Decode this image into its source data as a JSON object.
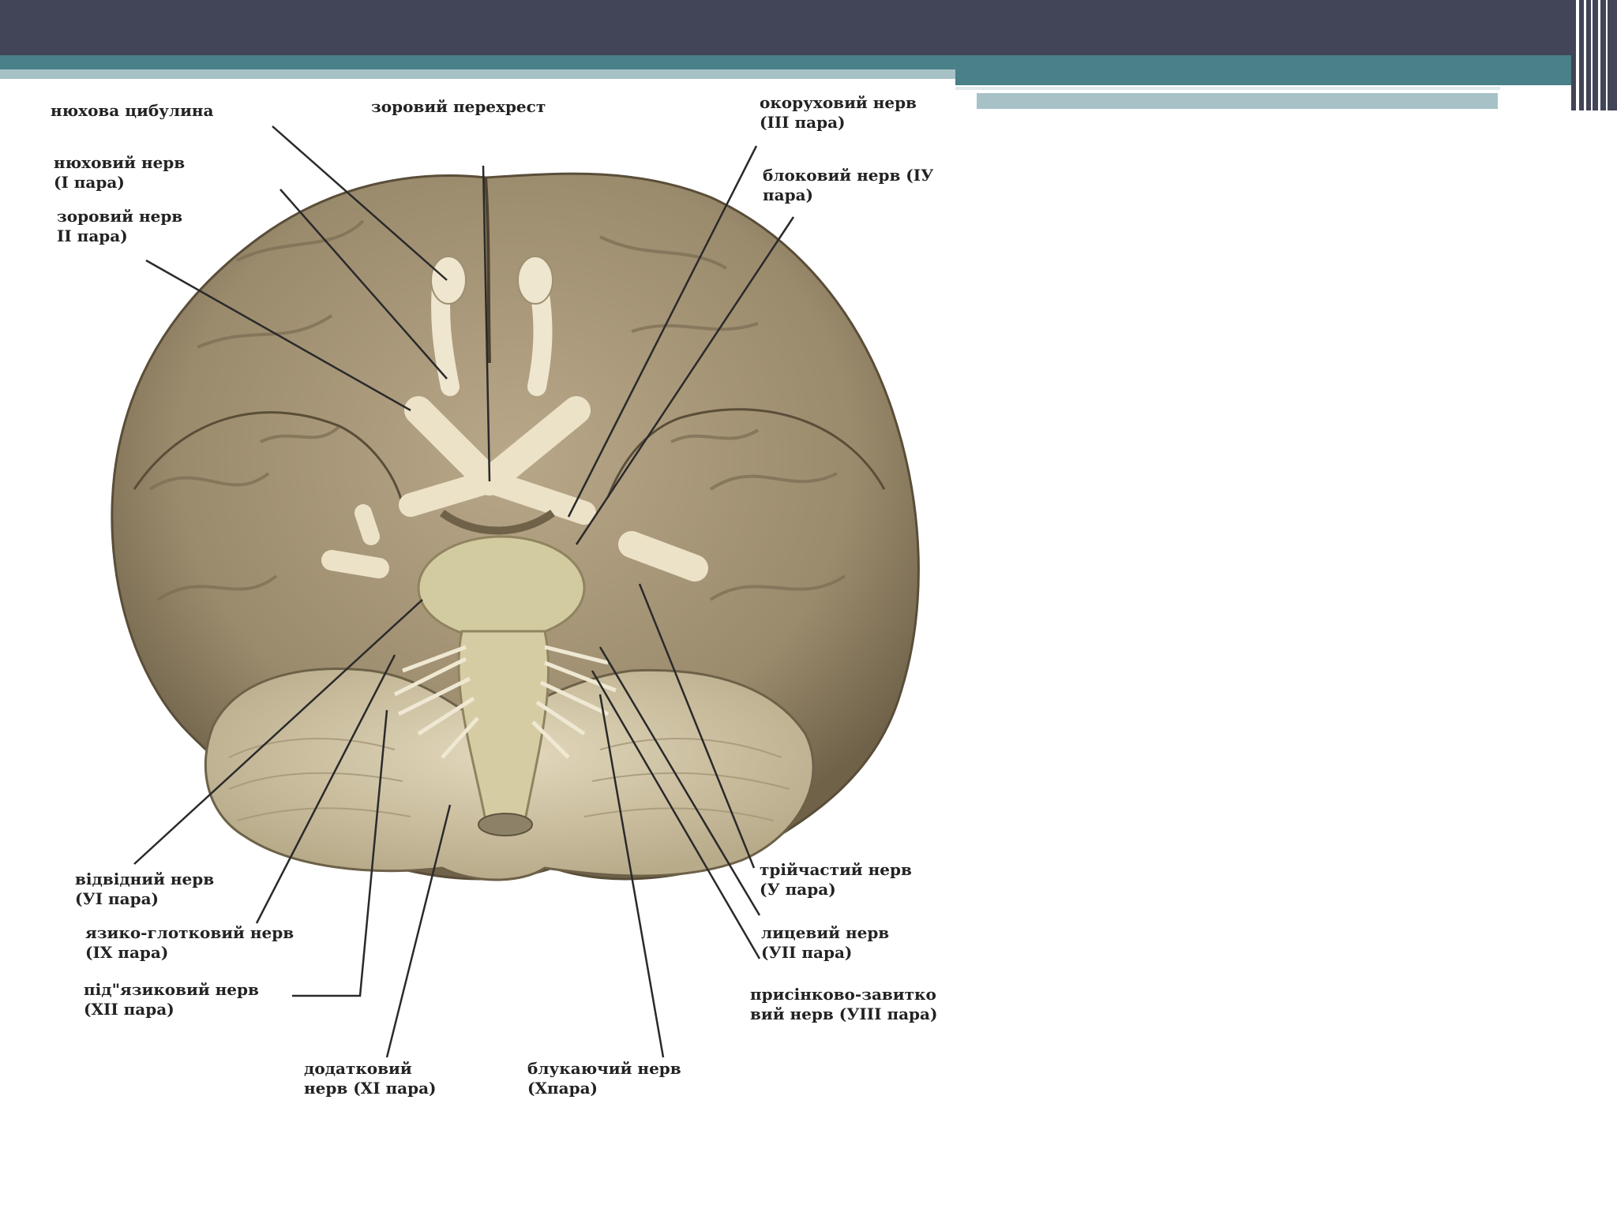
{
  "labels": {
    "olfactory_bulb": "нюхова цибулина",
    "optic_chiasm": "зоровий перехрест",
    "oculomotor": "окоруховий нерв\n(ІІІ пара)",
    "olfactory_nerve": "нюховий нерв\n(І пара)",
    "trochlear": "блоковий нерв (ІУ\nпара)",
    "optic_nerve": "зоровий нерв\nІІ пара)",
    "abducens": "відвідний нерв\n(УІ пара)",
    "glossopharyngeal": "язико-глотковий нерв\n(ІХ пара)",
    "hypoglossal": "під\"язиковий нерв\n(ХІІ пара)",
    "accessory": "додатковий\nнерв (ХІ пара)",
    "vagus": "блукаючий нерв\n(Хпара)",
    "trigeminal": "трійчастий нерв\n(У пара)",
    "facial": "лицевий нерв\n(УІІ пара)",
    "vestibulocochlear": "присінково-завитко\nвий нерв (УІІІ пара)"
  },
  "colors": {
    "header_dark": "#424457",
    "accent_teal": "#4a8088",
    "accent_light": "#a6c2c7"
  }
}
